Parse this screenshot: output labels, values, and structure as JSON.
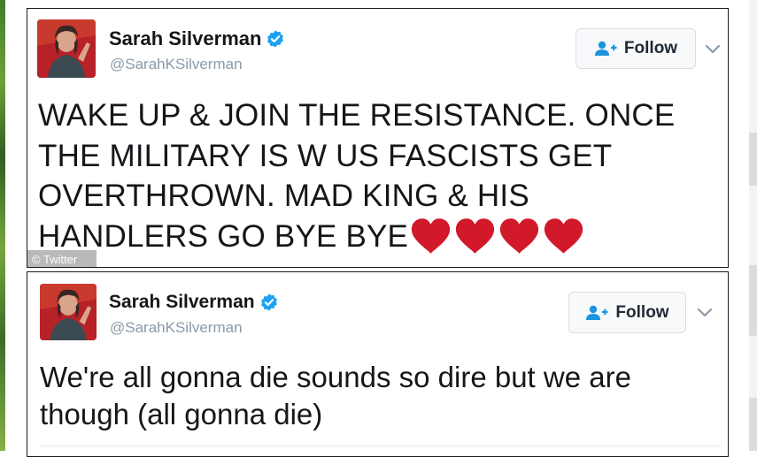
{
  "tweets": [
    {
      "author": {
        "name": "Sarah Silverman",
        "handle": "@SarahKSilverman",
        "verified": true
      },
      "follow_label": "Follow",
      "text": "WAKE UP & JOIN THE RESISTANCE.  ONCE\nTHE MILITARY IS W US FASCISTS GET\nOVERTHROWN. MAD KING & HIS\nHANDLERS GO BYE BYE",
      "emoji": [
        "red-heart",
        "red-heart",
        "red-heart",
        "red-heart"
      ],
      "credit": "© Twitter"
    },
    {
      "author": {
        "name": "Sarah Silverman",
        "handle": "@SarahKSilverman",
        "verified": true
      },
      "follow_label": "Follow",
      "text": "We're all gonna die sounds so dire but we are\nthough (all gonna die)"
    }
  ],
  "colors": {
    "verified_blue": "#1da1f2",
    "follow_icon_blue": "#1b95e0",
    "heart_red": "#d1192a",
    "handle_gray": "#8a9aa8",
    "avatar_red": "#b72128"
  }
}
